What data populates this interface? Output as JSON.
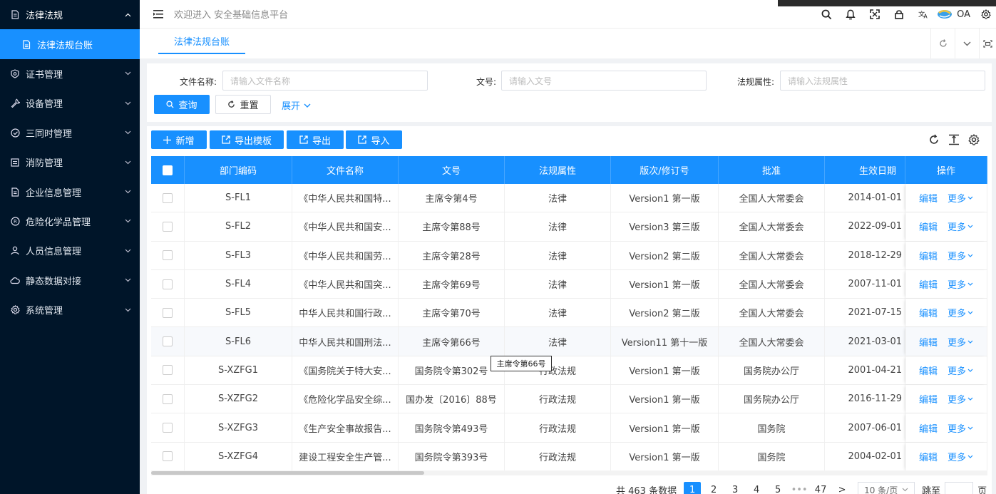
{
  "sidebar": {
    "items": [
      {
        "label": "法律法规",
        "icon": "document-icon",
        "expanded": true
      },
      {
        "label": "法律法规台账",
        "icon": "file-icon",
        "sub": true,
        "active": true
      },
      {
        "label": "证书管理",
        "icon": "badge-icon"
      },
      {
        "label": "设备管理",
        "icon": "wrench-icon"
      },
      {
        "label": "三同时管理",
        "icon": "check-circle-icon"
      },
      {
        "label": "消防管理",
        "icon": "list-icon"
      },
      {
        "label": "企业信息管理",
        "icon": "document-icon"
      },
      {
        "label": "危险化学品管理",
        "icon": "registered-icon"
      },
      {
        "label": "人员信息管理",
        "icon": "user-icon"
      },
      {
        "label": "静态数据对接",
        "icon": "cloud-icon"
      },
      {
        "label": "系统管理",
        "icon": "gear-icon"
      }
    ]
  },
  "header": {
    "welcome": "欢迎进入 安全基础信息平台",
    "oa_label": "OA"
  },
  "tabs": [
    {
      "label": "法律法规台账",
      "active": true
    }
  ],
  "search": {
    "fields": [
      {
        "label": "文件名称:",
        "placeholder": "请输入文件名称"
      },
      {
        "label": "文号:",
        "placeholder": "请输入文号"
      },
      {
        "label": "法规属性:",
        "placeholder": "请输入法规属性"
      }
    ],
    "query_label": "查询",
    "reset_label": "重置",
    "expand_label": "展开"
  },
  "toolbar": {
    "add_label": "新增",
    "export_template_label": "导出模板",
    "export_label": "导出",
    "import_label": "导入"
  },
  "table": {
    "columns": [
      "部门编码",
      "文件名称",
      "文号",
      "法规属性",
      "版次/修订号",
      "批准",
      "生效日期",
      "操作"
    ],
    "rows": [
      [
        "S-FL1",
        "《中华人民共和国特...",
        "主席令第4号",
        "法律",
        "Version1 第一版",
        "全国人大常委会",
        "2014-01-01"
      ],
      [
        "S-FL2",
        "《中华人民共和国安...",
        "主席令第88号",
        "法律",
        "Version3 第三版",
        "全国人大常委会",
        "2022-09-01"
      ],
      [
        "S-FL3",
        "《中华人民共和国劳...",
        "主席令第28号",
        "法律",
        "Version2 第二版",
        "全国人大常委会",
        "2018-12-29"
      ],
      [
        "S-FL4",
        "《中华人民共和国突...",
        "主席令第69号",
        "法律",
        "Version1 第一版",
        "全国人大常委会",
        "2007-11-01"
      ],
      [
        "S-FL5",
        "中华人民共和国行政...",
        "主席令第70号",
        "法律",
        "Version2 第二版",
        "全国人大常委会",
        "2021-07-15"
      ],
      [
        "S-FL6",
        "中华人民共和国刑法...",
        "主席令第66号",
        "法律",
        "Version11 第十一版",
        "全国人大常委会",
        "2021-03-01"
      ],
      [
        "S-XZFG1",
        "《国务院关于特大安...",
        "国务院令第302号",
        "行政法规",
        "Version1 第一版",
        "国务院办公厅",
        "2001-04-21"
      ],
      [
        "S-XZFG2",
        "《危险化学品安全综...",
        "国办发〔2016〕88号",
        "行政法规",
        "Version1 第一版",
        "国务院办公厅",
        "2016-11-29"
      ],
      [
        "S-XZFG3",
        "《生产安全事故报告...",
        "国务院令第493号",
        "行政法规",
        "Version1 第一版",
        "国务院",
        "2007-06-01"
      ],
      [
        "S-XZFG4",
        "建设工程安全生产管...",
        "国务院令第393号",
        "行政法规",
        "Version1 第一版",
        "国务院",
        "2004-02-01"
      ]
    ],
    "edit_label": "编辑",
    "more_label": "更多"
  },
  "tooltip": "主席令第66号",
  "pagination": {
    "total": "共 463 条数据",
    "pages": [
      "1",
      "2",
      "3",
      "4",
      "5",
      "•••",
      "47"
    ],
    "next": ">",
    "page_size": "10 条/页",
    "jump_label": "跳至",
    "jump_suffix": "页"
  },
  "colors": {
    "sidebar_bg": "#001529",
    "primary": "#1890ff"
  }
}
